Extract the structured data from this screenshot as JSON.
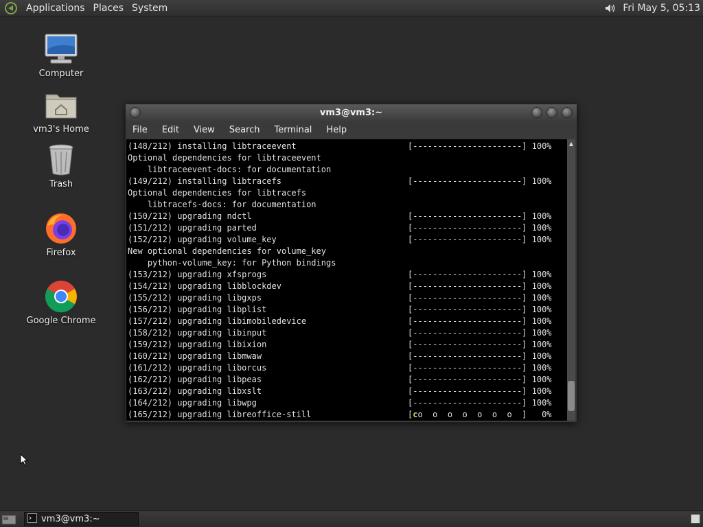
{
  "top_panel": {
    "menus": [
      "Applications",
      "Places",
      "System"
    ],
    "clock": "Fri May  5, 05:13"
  },
  "desktop_icons": [
    {
      "label": "Computer",
      "icon": "computer-icon"
    },
    {
      "label": "vm3's Home",
      "icon": "home-folder-icon"
    },
    {
      "label": "Trash",
      "icon": "trash-icon"
    },
    {
      "label": "Firefox",
      "icon": "firefox-icon"
    },
    {
      "label": "Google Chrome",
      "icon": "chrome-icon"
    }
  ],
  "window": {
    "title": "vm3@vm3:~",
    "menus": [
      "File",
      "Edit",
      "View",
      "Search",
      "Terminal",
      "Help"
    ]
  },
  "terminal_lines": [
    {
      "l": "(148/212) installing libtraceevent",
      "r": "[----------------------] 100%"
    },
    {
      "l": "Optional dependencies for libtraceevent",
      "r": ""
    },
    {
      "l": "    libtraceevent-docs: for documentation",
      "r": ""
    },
    {
      "l": "(149/212) installing libtracefs",
      "r": "[----------------------] 100%"
    },
    {
      "l": "Optional dependencies for libtracefs",
      "r": ""
    },
    {
      "l": "    libtracefs-docs: for documentation",
      "r": ""
    },
    {
      "l": "(150/212) upgrading ndctl",
      "r": "[----------------------] 100%"
    },
    {
      "l": "(151/212) upgrading parted",
      "r": "[----------------------] 100%"
    },
    {
      "l": "(152/212) upgrading volume_key",
      "r": "[----------------------] 100%"
    },
    {
      "l": "New optional dependencies for volume_key",
      "r": ""
    },
    {
      "l": "    python-volume_key: for Python bindings",
      "r": ""
    },
    {
      "l": "(153/212) upgrading xfsprogs",
      "r": "[----------------------] 100%"
    },
    {
      "l": "(154/212) upgrading libblockdev",
      "r": "[----------------------] 100%"
    },
    {
      "l": "(155/212) upgrading libgxps",
      "r": "[----------------------] 100%"
    },
    {
      "l": "(156/212) upgrading libplist",
      "r": "[----------------------] 100%"
    },
    {
      "l": "(157/212) upgrading libimobiledevice",
      "r": "[----------------------] 100%"
    },
    {
      "l": "(158/212) upgrading libinput",
      "r": "[----------------------] 100%"
    },
    {
      "l": "(159/212) upgrading libixion",
      "r": "[----------------------] 100%"
    },
    {
      "l": "(160/212) upgrading libmwaw",
      "r": "[----------------------] 100%"
    },
    {
      "l": "(161/212) upgrading liborcus",
      "r": "[----------------------] 100%"
    },
    {
      "l": "(162/212) upgrading libpeas",
      "r": "[----------------------] 100%"
    },
    {
      "l": "(163/212) upgrading libxslt",
      "r": "[----------------------] 100%"
    },
    {
      "l": "(164/212) upgrading libwpg",
      "r": "[----------------------] 100%"
    }
  ],
  "last_line": {
    "l": "(165/212) upgrading libreoffice-still",
    "bar_start": "[",
    "bar_c": "c",
    "bar_rest": "o  o  o  o  o  o  o  ]   0%"
  },
  "taskbar": {
    "task_label": "vm3@vm3:~"
  },
  "colors": {
    "desktop": "#2b2b2b",
    "terminal_bg": "#000000",
    "terminal_fg": "#e0e0e0",
    "pacman": "#e0d060"
  }
}
